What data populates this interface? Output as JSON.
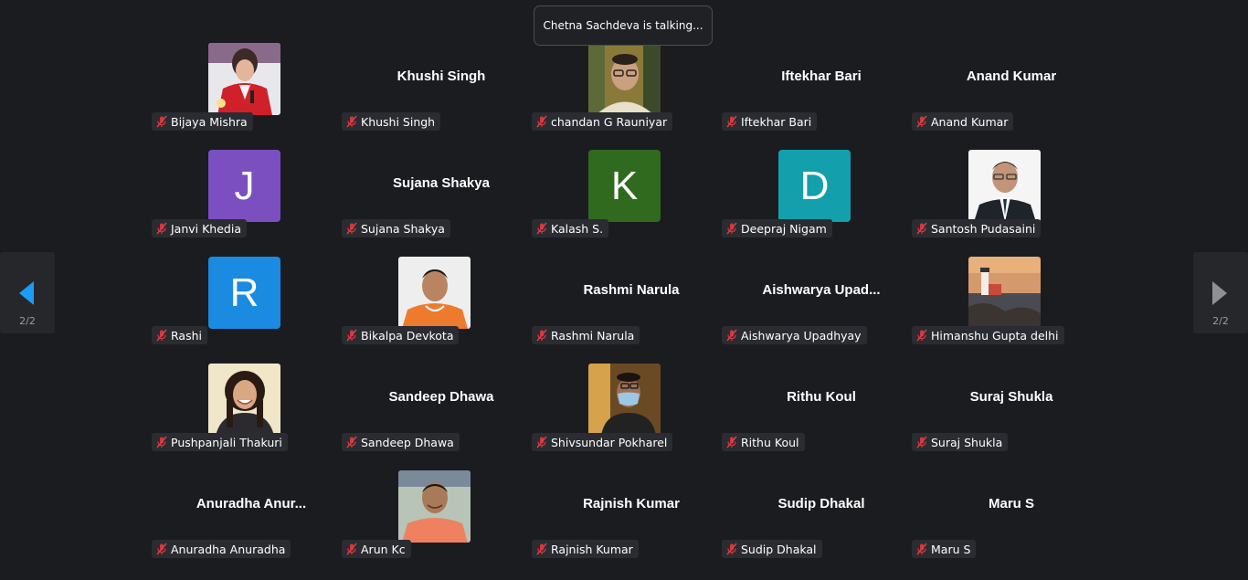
{
  "notification": "Chetna Sachdeva is talking...",
  "pager": {
    "left_page": "2/2",
    "right_page": "2/2"
  },
  "colors": {
    "purple": "#7b4fc0",
    "green": "#2f6a1f",
    "teal": "#13a0ac",
    "blue": "#1a8be0",
    "mic_muted": "#d9343a"
  },
  "participants": [
    {
      "label": "Bijaya Mishra",
      "display": "",
      "avatar": "photo-woman-red"
    },
    {
      "label": "Khushi Singh",
      "display": "Khushi Singh",
      "avatar": "none"
    },
    {
      "label": "chandan G Rauniyar",
      "display": "",
      "avatar": "photo-man-glasses"
    },
    {
      "label": "Iftekhar Bari",
      "display": "Iftekhar Bari",
      "avatar": "none"
    },
    {
      "label": "Anand Kumar",
      "display": "Anand Kumar",
      "avatar": "none"
    },
    {
      "label": "Janvi Khedia",
      "display": "",
      "avatar": "letter",
      "letter": "J",
      "color": "#7b4fc0"
    },
    {
      "label": "Sujana Shakya",
      "display": "Sujana Shakya",
      "avatar": "none"
    },
    {
      "label": "Kalash S.",
      "display": "",
      "avatar": "letter",
      "letter": "K",
      "color": "#2f6a1f"
    },
    {
      "label": "Deepraj Nigam",
      "display": "",
      "avatar": "letter",
      "letter": "D",
      "color": "#13a0ac"
    },
    {
      "label": "Santosh Pudasaini",
      "display": "",
      "avatar": "photo-man-suit"
    },
    {
      "label": "Rashi",
      "display": "",
      "avatar": "letter",
      "letter": "R",
      "color": "#1a8be0"
    },
    {
      "label": "Bikalpa Devkota",
      "display": "",
      "avatar": "photo-man-orange"
    },
    {
      "label": "Rashmi Narula",
      "display": "Rashmi Narula",
      "avatar": "none"
    },
    {
      "label": "Aishwarya Upadhyay",
      "display": "Aishwarya  Upad...",
      "avatar": "none"
    },
    {
      "label": "Himanshu Gupta delhi",
      "display": "",
      "avatar": "photo-lighthouse"
    },
    {
      "label": "Pushpanjali Thakuri",
      "display": "",
      "avatar": "photo-woman-smile"
    },
    {
      "label": "Sandeep Dhawa",
      "display": "Sandeep Dhawa",
      "avatar": "none"
    },
    {
      "label": "Shivsundar Pokharel",
      "display": "",
      "avatar": "photo-man-mask"
    },
    {
      "label": "Rithu Koul",
      "display": "Rithu Koul",
      "avatar": "none"
    },
    {
      "label": "Suraj Shukla",
      "display": "Suraj Shukla",
      "avatar": "none"
    },
    {
      "label": "Anuradha Anuradha",
      "display": "Anuradha  Anur...",
      "avatar": "none"
    },
    {
      "label": "Arun Kc",
      "display": "",
      "avatar": "photo-man-salmon"
    },
    {
      "label": "Rajnish Kumar",
      "display": "Rajnish Kumar",
      "avatar": "none"
    },
    {
      "label": "Sudip Dhakal",
      "display": "Sudip Dhakal",
      "avatar": "none"
    },
    {
      "label": "Maru S",
      "display": "Maru S",
      "avatar": "none"
    }
  ]
}
